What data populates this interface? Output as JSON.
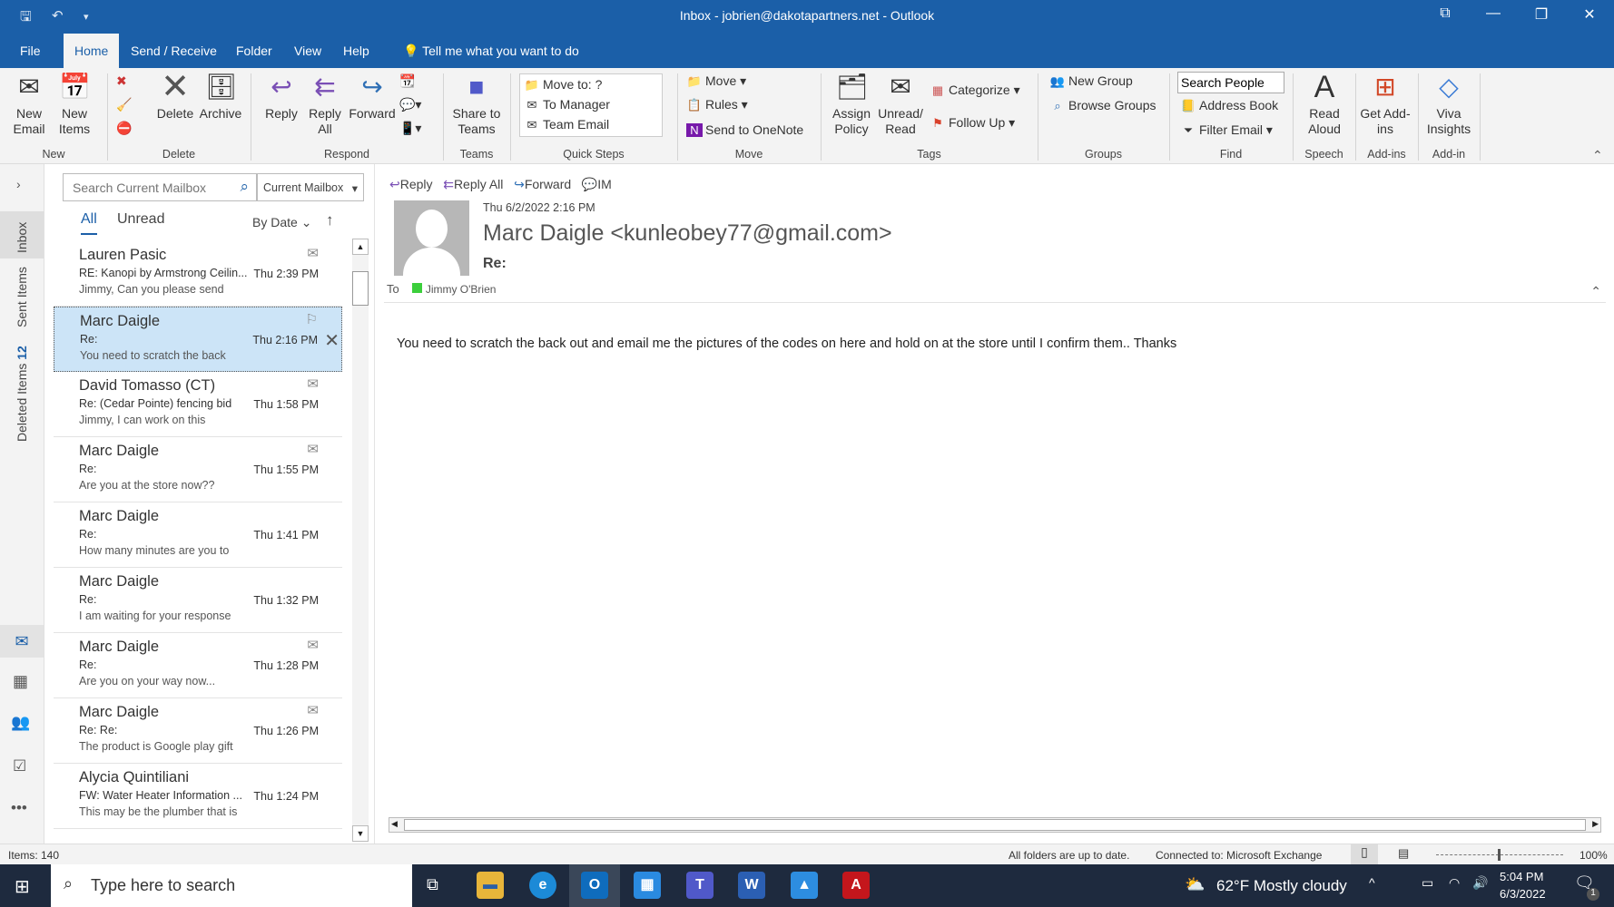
{
  "window": {
    "title": "Inbox - jobrien@dakotapartners.net  -  Outlook"
  },
  "tabs": [
    "File",
    "Home",
    "Send / Receive",
    "Folder",
    "View",
    "Help"
  ],
  "tell_me": "Tell me what you want to do",
  "ribbon": {
    "new_email": "New Email",
    "new_items": "New Items",
    "delete": "Delete",
    "archive": "Archive",
    "reply": "Reply",
    "reply_all": "Reply All",
    "forward": "Forward",
    "share_teams": "Share to Teams",
    "quick_steps": [
      "Move to: ?",
      "To Manager",
      "Team Email"
    ],
    "move": "Move",
    "rules": "Rules",
    "onenote": "Send to OneNote",
    "assign_policy": "Assign Policy",
    "unread_read": "Unread/ Read",
    "categorize": "Categorize",
    "follow_up": "Follow Up",
    "new_group": "New Group",
    "browse_groups": "Browse Groups",
    "search_people": "Search People",
    "address_book": "Address Book",
    "filter_email": "Filter Email",
    "read_aloud": "Read Aloud",
    "get_addins": "Get Add-ins",
    "viva": "Viva Insights",
    "groups": [
      "New",
      "Delete",
      "Respond",
      "Teams",
      "Quick Steps",
      "Move",
      "Tags",
      "Groups",
      "Find",
      "Speech",
      "Add-ins",
      "Add-in"
    ]
  },
  "nav": {
    "inbox": "Inbox",
    "sent": "Sent Items",
    "deleted": "Deleted Items",
    "deleted_count": "12"
  },
  "list": {
    "search_placeholder": "Search Current Mailbox",
    "scope": "Current Mailbox",
    "filter_all": "All",
    "filter_unread": "Unread",
    "sort": "By Date",
    "messages": [
      {
        "from": "Lauren Pasic",
        "subject": "RE: Kanopi by Armstrong Ceilin...",
        "preview": "Jimmy,   Can you please send",
        "time": "Thu 2:39 PM",
        "icon": "replied"
      },
      {
        "from": "Marc Daigle",
        "subject": "Re:",
        "preview": "You need to scratch the back",
        "time": "Thu 2:16 PM",
        "icon": "flag",
        "selected": true
      },
      {
        "from": "David Tomasso (CT)",
        "subject": "Re: (Cedar Pointe) fencing bid",
        "preview": "Jimmy,  I can work on this",
        "time": "Thu 1:58 PM",
        "icon": "replied"
      },
      {
        "from": "Marc Daigle",
        "subject": "Re:",
        "preview": "Are you at the store now??",
        "time": "Thu 1:55 PM",
        "icon": "replied"
      },
      {
        "from": "Marc Daigle",
        "subject": "Re:",
        "preview": "How many minutes are you to",
        "time": "Thu 1:41 PM",
        "icon": ""
      },
      {
        "from": "Marc Daigle",
        "subject": "Re:",
        "preview": "I am waiting for your response",
        "time": "Thu 1:32 PM",
        "icon": ""
      },
      {
        "from": "Marc Daigle",
        "subject": "Re:",
        "preview": "Are you on your way now...",
        "time": "Thu 1:28 PM",
        "icon": "replied"
      },
      {
        "from": "Marc Daigle",
        "subject": "Re: Re:",
        "preview": "The product is Google play gift",
        "time": "Thu 1:26 PM",
        "icon": "replied"
      },
      {
        "from": "Alycia Quintiliani",
        "subject": "FW: Water Heater Information ...",
        "preview": "This may be the plumber that is",
        "time": "Thu 1:24 PM",
        "icon": ""
      }
    ]
  },
  "reading": {
    "actions": [
      "Reply",
      "Reply All",
      "Forward",
      "IM"
    ],
    "date": "Thu 6/2/2022 2:16 PM",
    "sender": "Marc Daigle <kunleobey77@gmail.com>",
    "subject": "Re:",
    "to_label": "To",
    "to": "Jimmy O'Brien",
    "body": "You need to scratch the back out and email me the pictures of the codes on here and hold on at the store until I confirm them.. Thanks"
  },
  "status": {
    "items": "Items: 140",
    "sync": "All folders are up to date.",
    "connection": "Connected to: Microsoft Exchange",
    "zoom": "100%"
  },
  "taskbar": {
    "search": "Type here to search",
    "weather": "62°F  Mostly cloudy",
    "time": "5:04 PM",
    "date": "6/3/2022",
    "notifications": "1"
  }
}
